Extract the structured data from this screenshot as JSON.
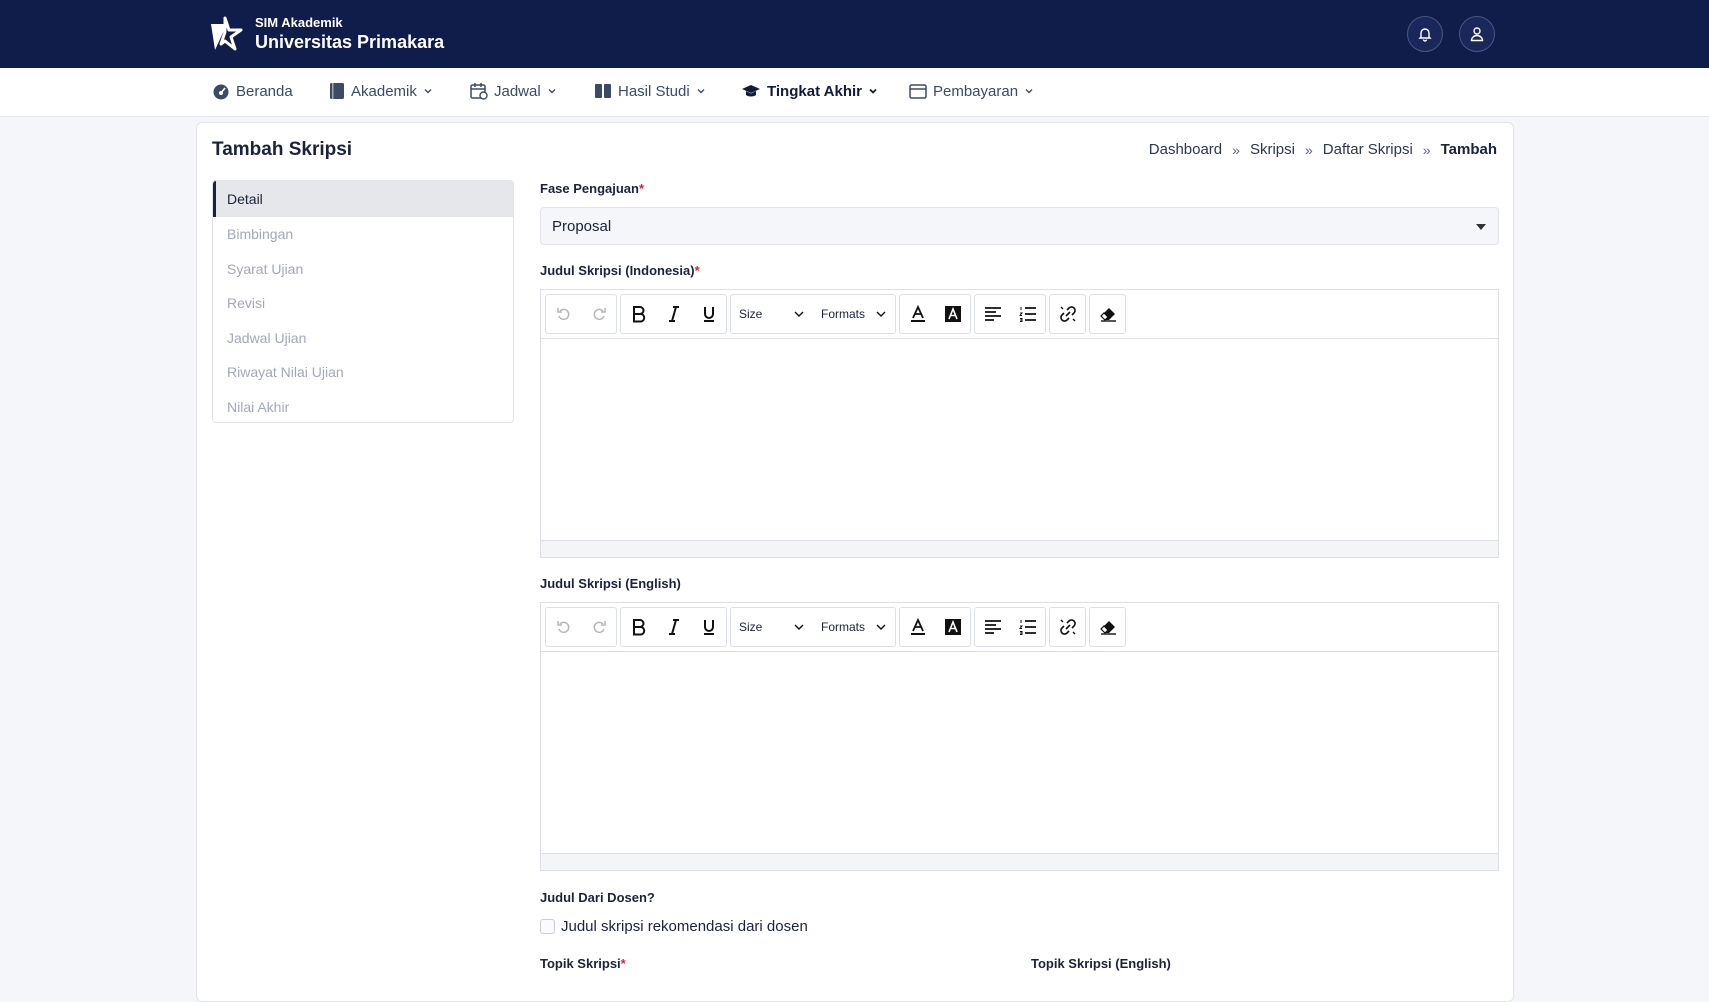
{
  "header": {
    "app_small": "SIM Akademik",
    "app_title": "Universitas Primakara",
    "icons": [
      "bell-icon",
      "user-icon"
    ]
  },
  "menu": {
    "items": [
      {
        "label": "Beranda",
        "icon": "dashboard-icon"
      },
      {
        "label": "Akademik",
        "icon": "book-icon"
      },
      {
        "label": "Jadwal",
        "icon": "calendar-icon"
      },
      {
        "label": "Hasil Studi",
        "icon": "open-book-icon"
      },
      {
        "label": "Tingkat Akhir",
        "icon": "graduation-cap-icon",
        "active": true
      },
      {
        "label": "Pembayaran",
        "icon": "card-icon"
      }
    ]
  },
  "page": {
    "title": "Tambah Skripsi",
    "breadcrumb": [
      "Dashboard",
      "Skripsi",
      "Daftar Skripsi",
      "Tambah"
    ],
    "breadcrumb_sep": "»"
  },
  "sidenav": {
    "items": [
      "Detail",
      "Bimbingan",
      "Syarat Ujian",
      "Revisi",
      "Jadwal Ujian",
      "Riwayat Nilai Ujian",
      "Nilai Akhir"
    ],
    "active": "Detail"
  },
  "form": {
    "fase": {
      "label": "Fase Pengajuan",
      "required": "*",
      "value": "Proposal"
    },
    "judul_id": {
      "label": "Judul Skripsi (Indonesia)",
      "required": "*"
    },
    "judul_en": {
      "label": "Judul Skripsi (English)"
    },
    "toolbar": {
      "size_label": "Size",
      "formats_label": "Formats"
    },
    "dosen": {
      "label": "Judul Dari Dosen?",
      "checkbox_label": "Judul skripsi rekomendasi dari dosen",
      "checked": false
    },
    "topik": {
      "label": "Topik Skripsi",
      "required": "*"
    },
    "topik_en": {
      "label": "Topik Skripsi (English)"
    }
  },
  "colors": {
    "navy": "#101c4a",
    "required": "#d0283a"
  }
}
